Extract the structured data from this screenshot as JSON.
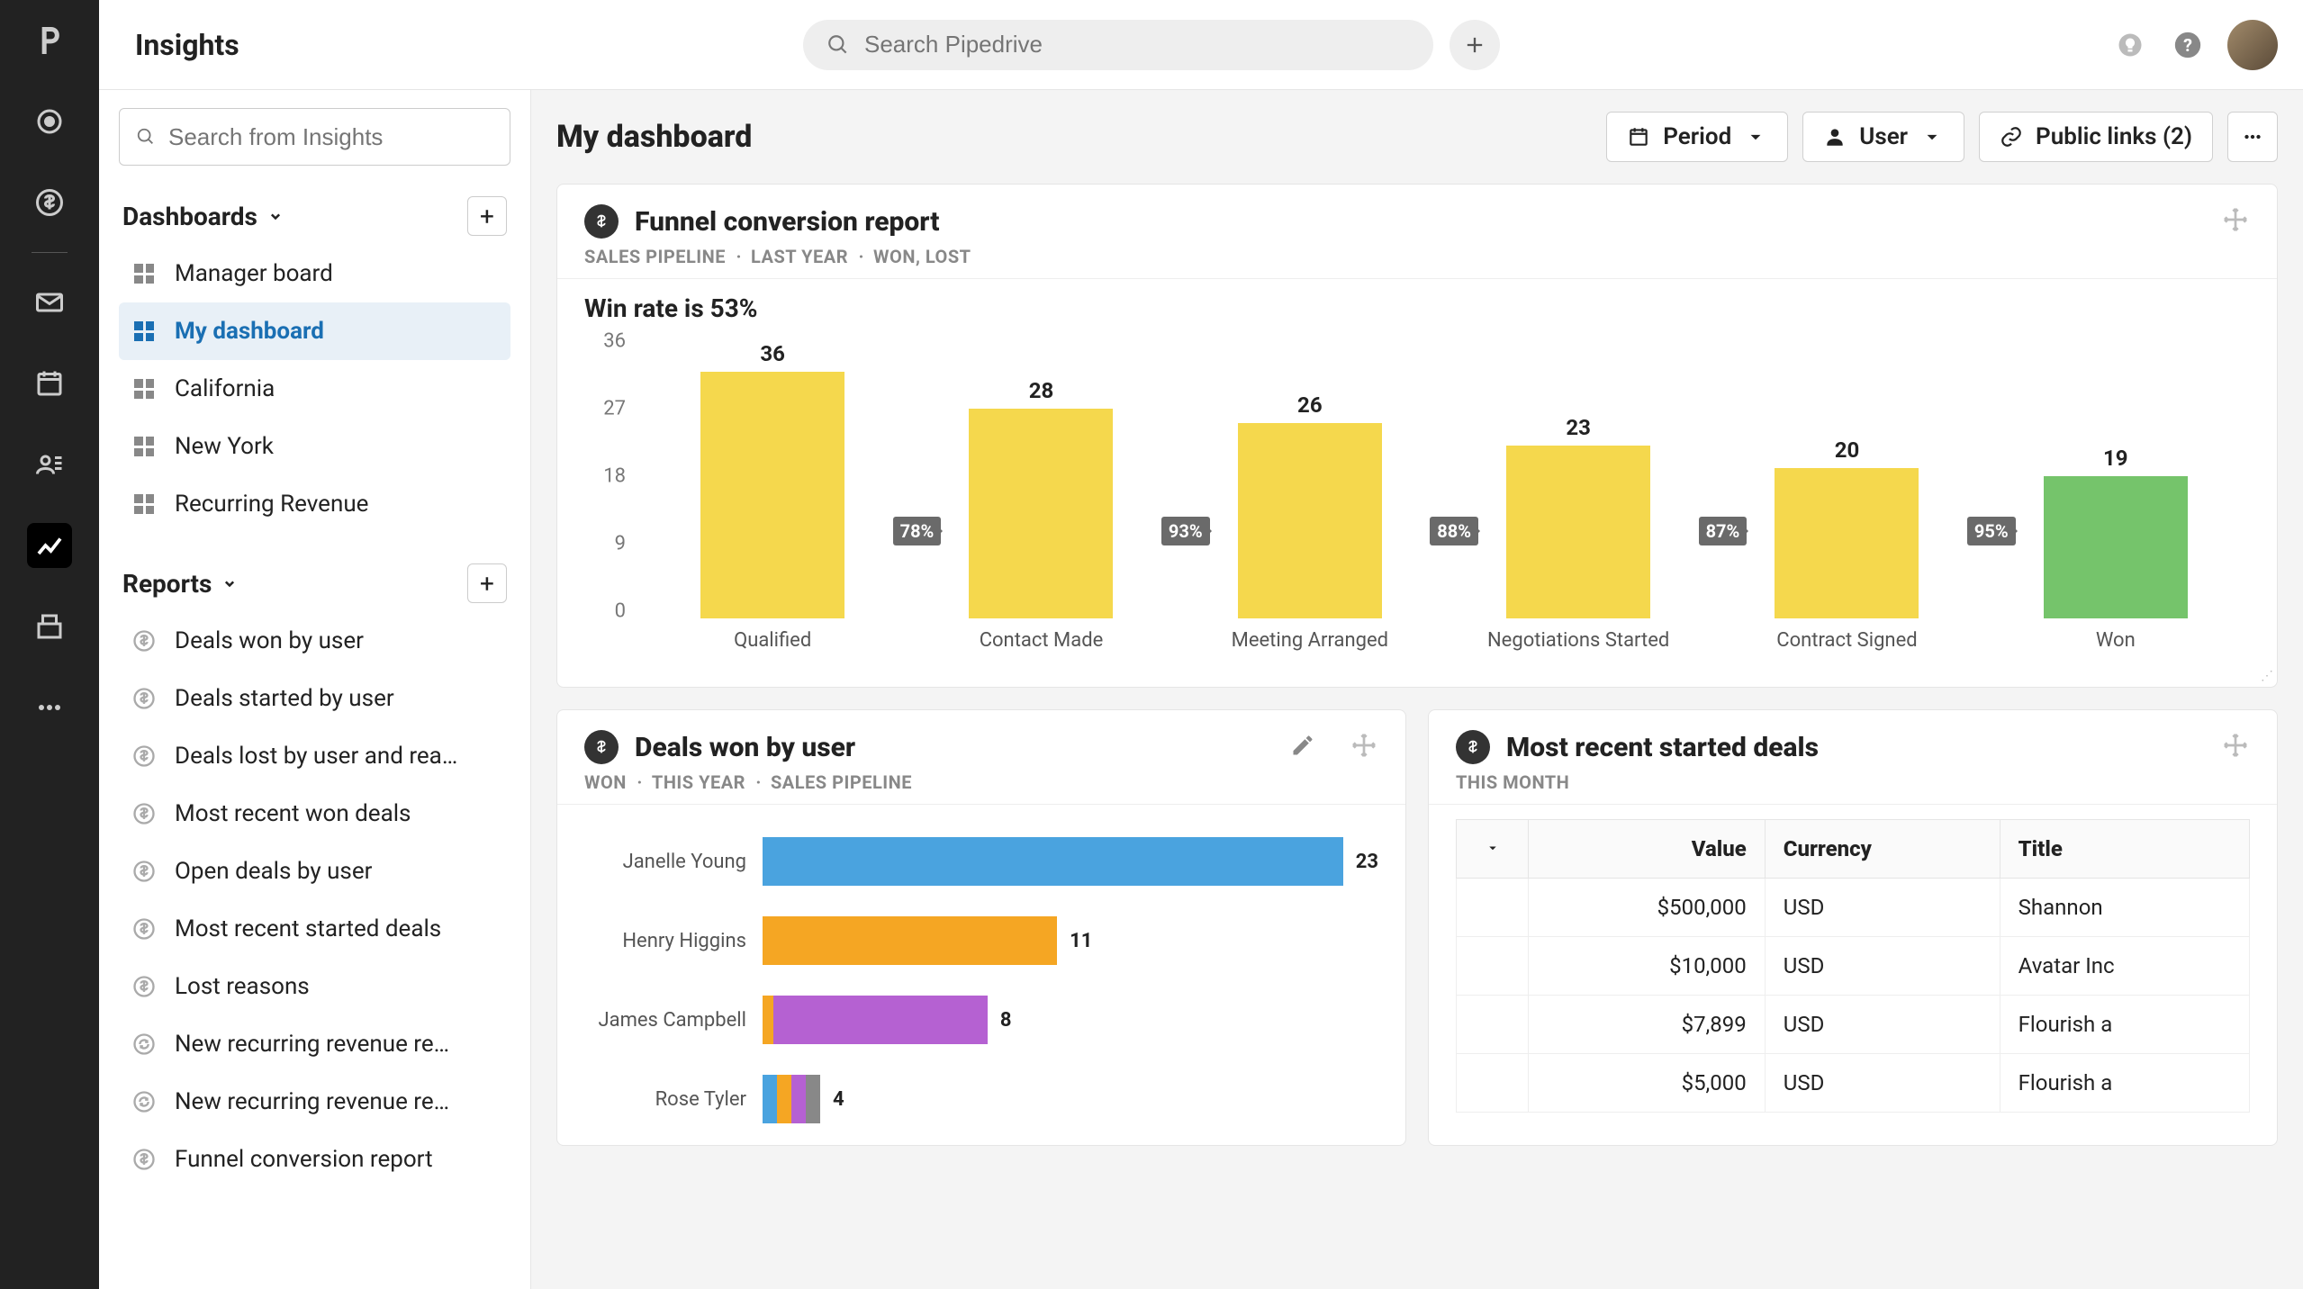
{
  "app_title": "Insights",
  "global_search_placeholder": "Search Pipedrive",
  "sidebar": {
    "search_placeholder": "Search from Insights",
    "sections": {
      "dashboards": {
        "title": "Dashboards",
        "items": [
          "Manager board",
          "My dashboard",
          "California",
          "New York",
          "Recurring Revenue"
        ],
        "active_index": 1
      },
      "reports": {
        "title": "Reports",
        "items": [
          {
            "icon": "dollar",
            "label": "Deals won by user"
          },
          {
            "icon": "dollar",
            "label": "Deals started by user"
          },
          {
            "icon": "dollar",
            "label": "Deals lost by user and rea…"
          },
          {
            "icon": "dollar",
            "label": "Most recent won deals"
          },
          {
            "icon": "dollar",
            "label": "Open deals by user"
          },
          {
            "icon": "dollar",
            "label": "Most recent started deals"
          },
          {
            "icon": "dollar",
            "label": "Lost reasons"
          },
          {
            "icon": "recur",
            "label": "New recurring revenue re…"
          },
          {
            "icon": "recur",
            "label": "New recurring revenue re…"
          },
          {
            "icon": "dollar",
            "label": "Funnel conversion report"
          }
        ]
      }
    }
  },
  "workspace": {
    "title": "My dashboard",
    "buttons": {
      "period": "Period",
      "user": "User",
      "public_links": "Public links (2)"
    },
    "funnel_card": {
      "title": "Funnel conversion report",
      "meta": [
        "SALES PIPELINE",
        "LAST YEAR",
        "WON, LOST"
      ],
      "winrate": "Win rate is 53%"
    },
    "deals_won_card": {
      "title": "Deals won by user",
      "meta": [
        "WON",
        "THIS YEAR",
        "SALES PIPELINE"
      ]
    },
    "recent_card": {
      "title": "Most recent started deals",
      "meta": [
        "THIS MONTH"
      ],
      "columns": {
        "value": "Value",
        "currency": "Currency",
        "title": "Title"
      },
      "rows": [
        {
          "value": "$500,000",
          "currency": "USD",
          "title": "Shannon"
        },
        {
          "value": "$10,000",
          "currency": "USD",
          "title": "Avatar Inc"
        },
        {
          "value": "$7,899",
          "currency": "USD",
          "title": "Flourish a"
        },
        {
          "value": "$5,000",
          "currency": "USD",
          "title": "Flourish a"
        }
      ]
    }
  },
  "chart_data": [
    {
      "id": "funnel",
      "type": "bar",
      "title": "Funnel conversion report",
      "ylim": [
        0,
        36
      ],
      "yticks": [
        0,
        9,
        18,
        27,
        36
      ],
      "categories": [
        "Qualified",
        "Contact Made",
        "Meeting Arranged",
        "Negotiations Started",
        "Contract Signed",
        "Won"
      ],
      "values": [
        36,
        28,
        26,
        23,
        20,
        19
      ],
      "conversion_between": [
        "78%",
        "93%",
        "88%",
        "87%",
        "95%"
      ],
      "colors": [
        "#f5d84d",
        "#f5d84d",
        "#f5d84d",
        "#f5d84d",
        "#f5d84d",
        "#75c46b"
      ]
    },
    {
      "id": "deals_won",
      "type": "bar",
      "orientation": "horizontal",
      "title": "Deals won by user",
      "categories": [
        "Janelle Young",
        "Henry Higgins",
        "James Campbell",
        "Rose Tyler"
      ],
      "values": [
        23,
        11,
        8,
        4
      ],
      "colors": [
        "#4aa3df",
        "#f5a623",
        "#b561d2",
        "stacked"
      ],
      "stacked_last": [
        {
          "color": "#4aa3df"
        },
        {
          "color": "#f5a623"
        },
        {
          "color": "#b561d2"
        },
        {
          "color": "#888"
        }
      ],
      "xlim": [
        0,
        23
      ]
    }
  ]
}
